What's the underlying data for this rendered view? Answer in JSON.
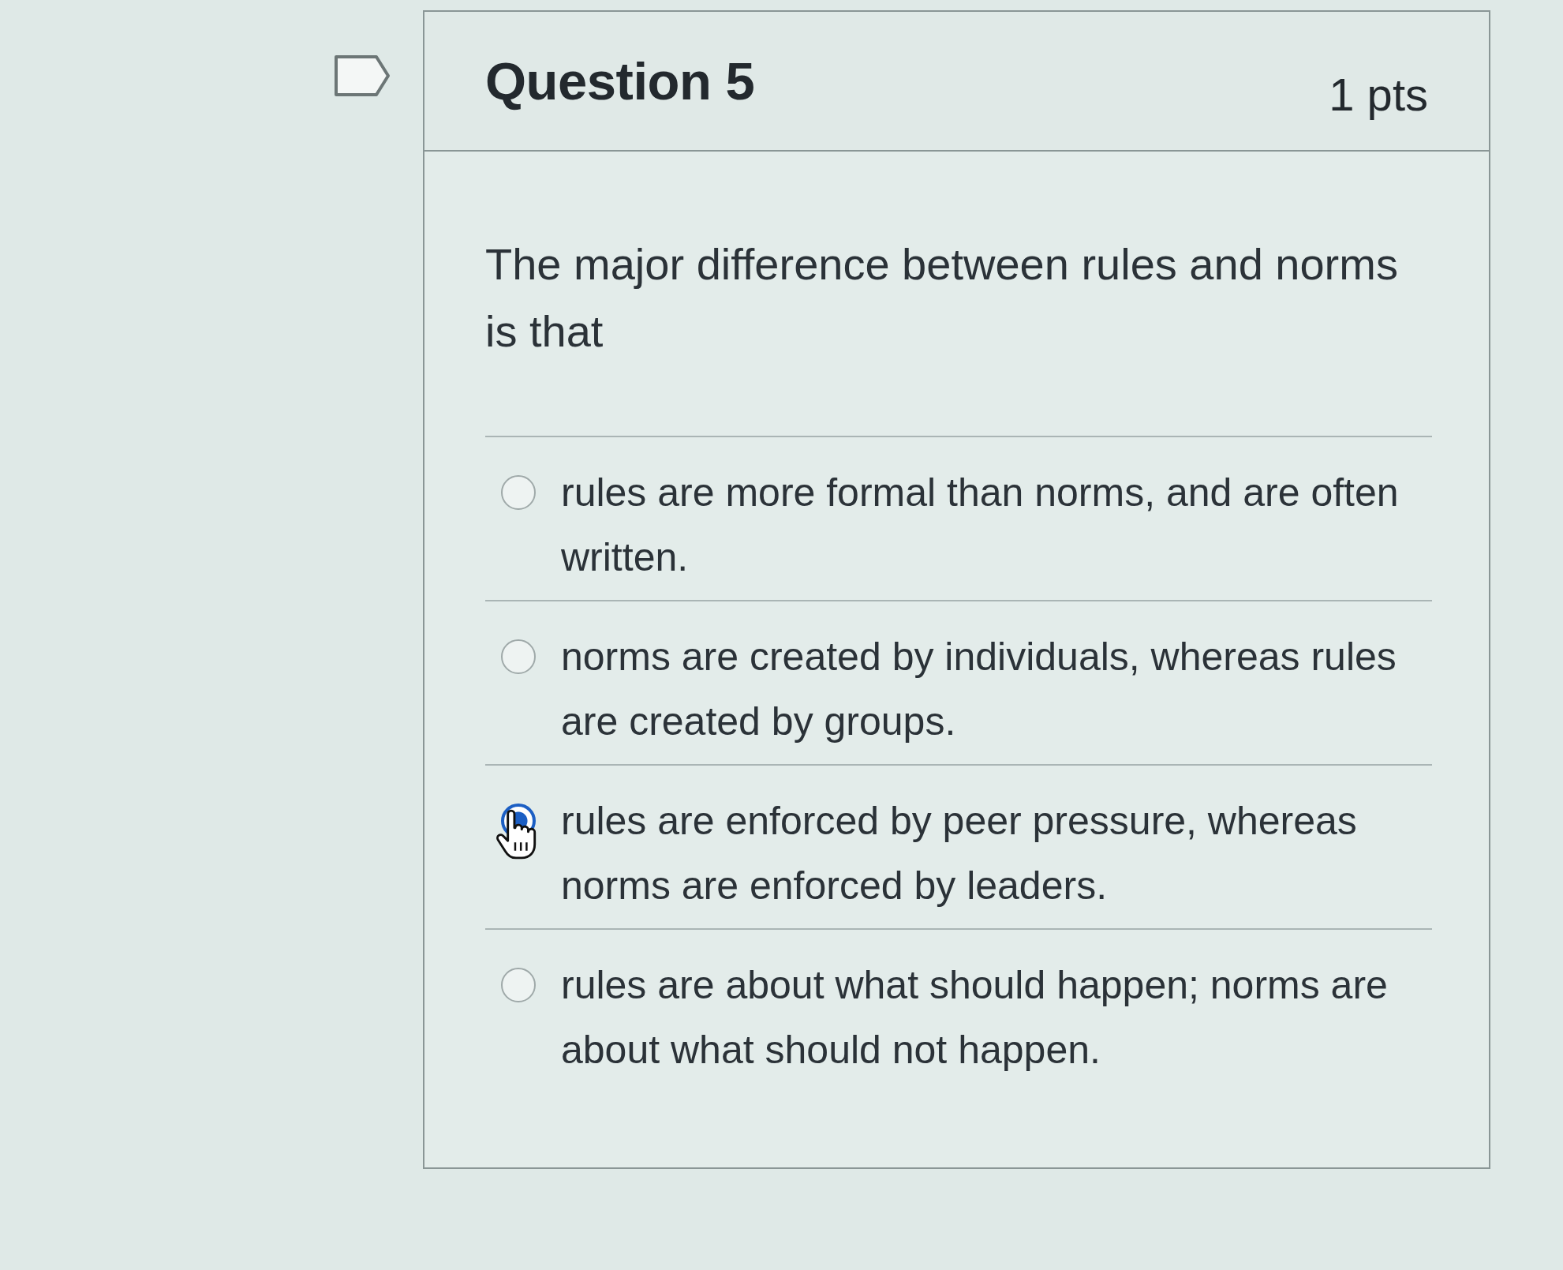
{
  "question": {
    "title": "Question 5",
    "points": "1 pts",
    "flagged": false,
    "text": "The major difference between rules and norms is that"
  },
  "answers": [
    {
      "text": "rules are more formal than norms, and are often written.",
      "selected": false
    },
    {
      "text": "norms are created by individuals, whereas rules are created by groups.",
      "selected": false
    },
    {
      "text": "rules are enforced by peer pressure, whereas norms are enforced by leaders.",
      "selected": true
    },
    {
      "text": "rules are about what should happen; norms are about what should not happen.",
      "selected": false
    }
  ]
}
